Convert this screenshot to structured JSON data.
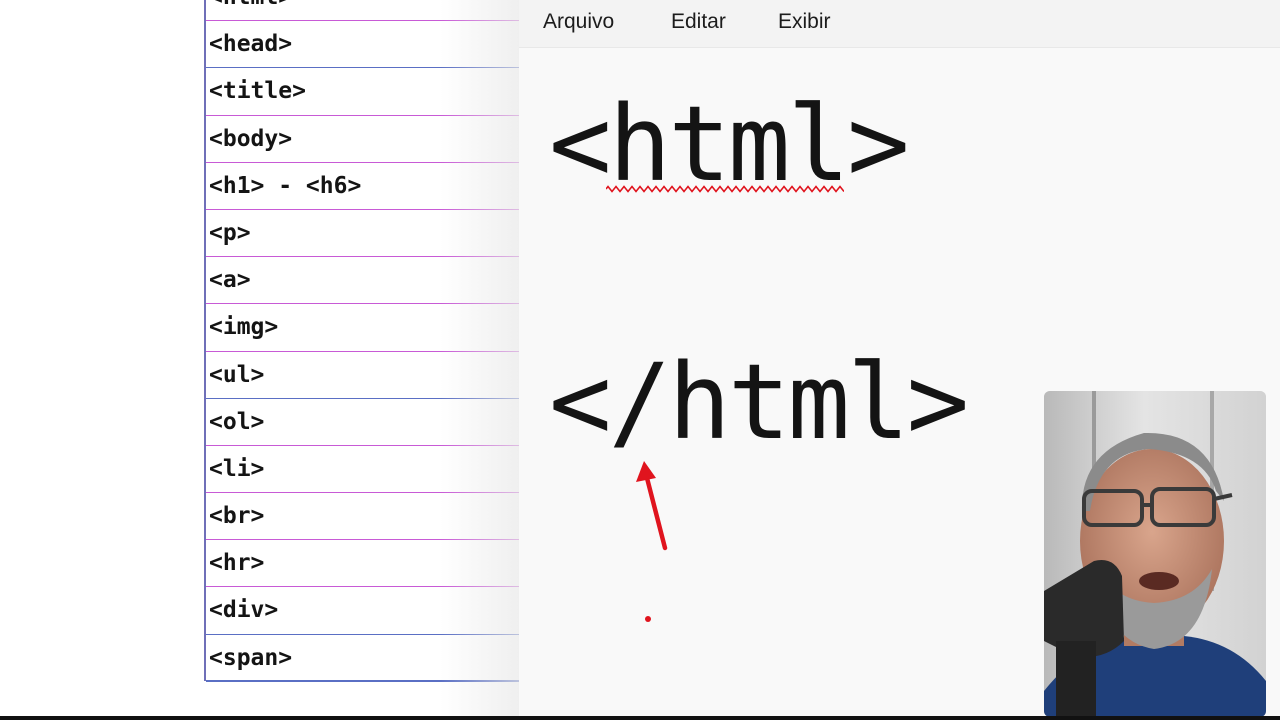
{
  "tag_list": {
    "items": [
      {
        "label": "<html>"
      },
      {
        "label": "<head>"
      },
      {
        "label": "<title>"
      },
      {
        "label": "<body>"
      },
      {
        "label": "<h1> - <h6>"
      },
      {
        "label": "<p>"
      },
      {
        "label": "<a>"
      },
      {
        "label": "<img>"
      },
      {
        "label": "<ul>"
      },
      {
        "label": "<ol>"
      },
      {
        "label": "<li>"
      },
      {
        "label": "<br>"
      },
      {
        "label": "<hr>"
      },
      {
        "label": "<div>"
      },
      {
        "label": "<span>"
      }
    ]
  },
  "notepad": {
    "menu": {
      "file": "Arquivo",
      "edit": "Editar",
      "view": "Exibir"
    },
    "content": {
      "line1": "<html>",
      "line2": "</html>"
    }
  },
  "colors": {
    "list_line_pink": "#c85ad6",
    "list_line_blue": "#5a6fc4",
    "annotation_red": "#e0141e",
    "spellcheck_red": "#e0141e"
  },
  "webcam": {
    "present": true
  }
}
